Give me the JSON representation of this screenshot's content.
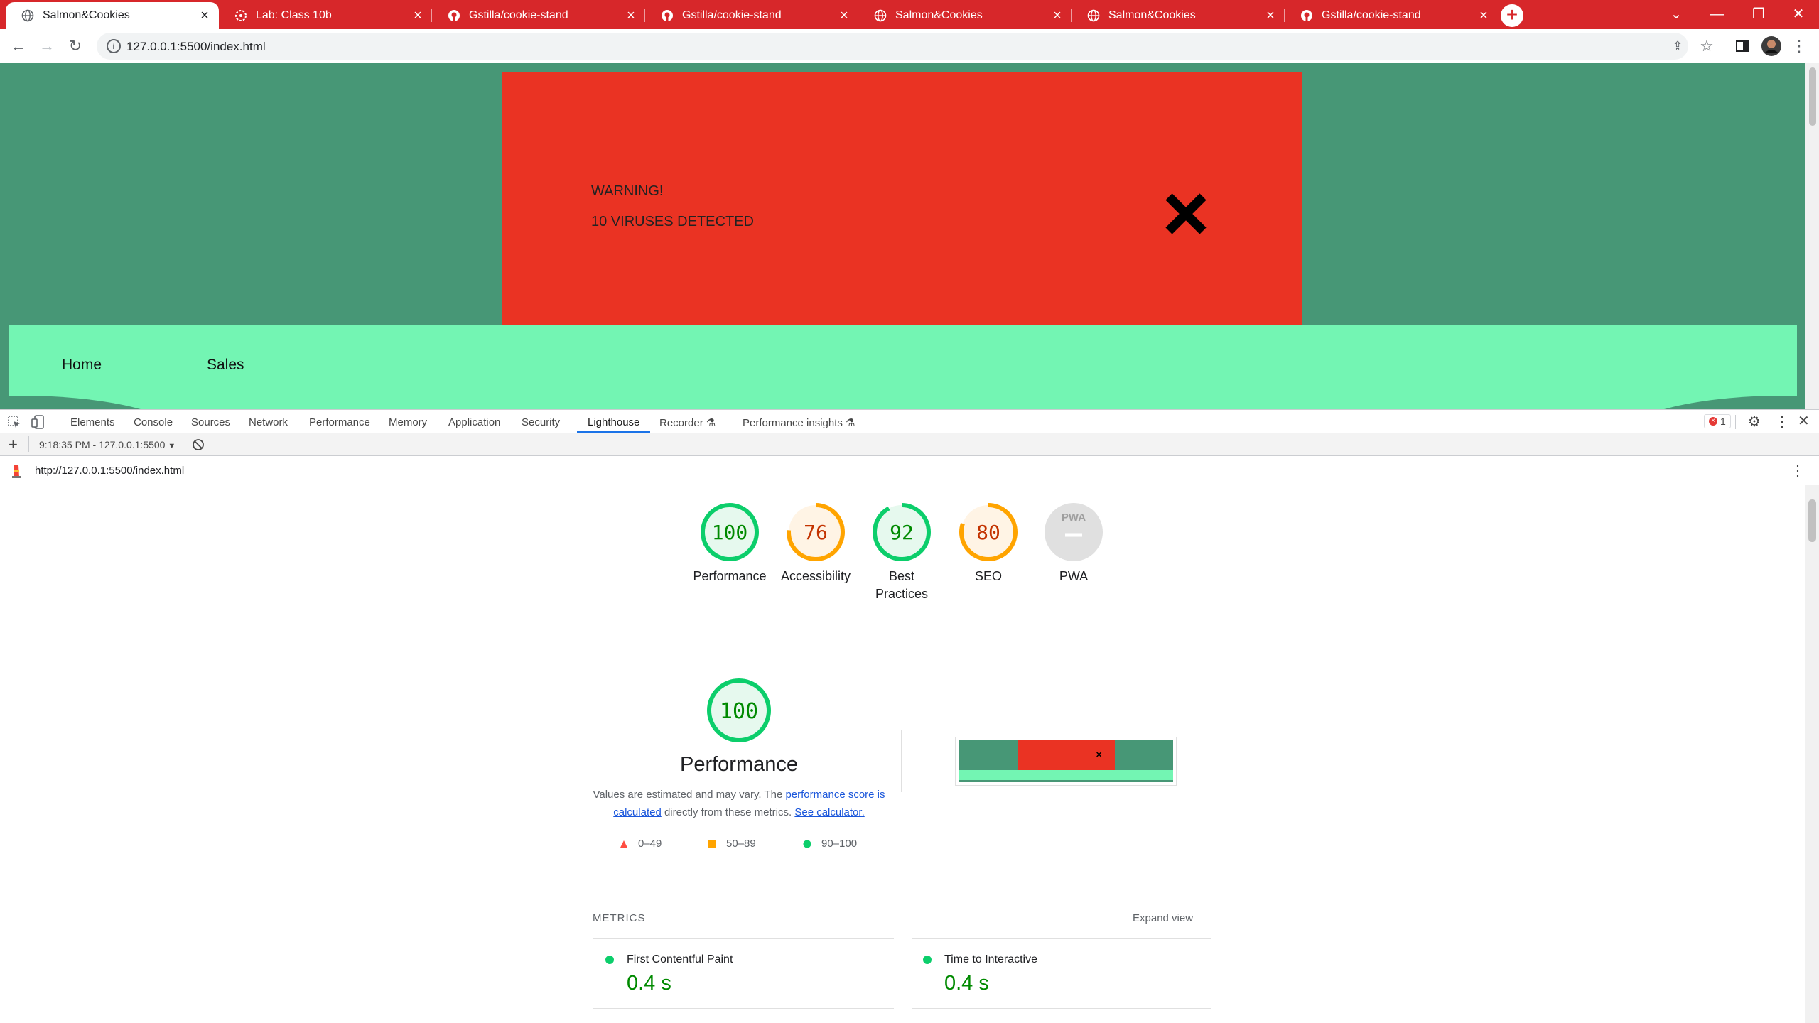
{
  "browser": {
    "tabs": [
      {
        "title": "Salmon&Cookies",
        "favicon": "globe-icon",
        "active": true
      },
      {
        "title": "Lab: Class 10b",
        "favicon": "canvas-icon",
        "active": false
      },
      {
        "title": "Gstilla/cookie-stand",
        "favicon": "github-icon",
        "active": false
      },
      {
        "title": "Gstilla/cookie-stand",
        "favicon": "github-icon",
        "active": false
      },
      {
        "title": "Salmon&Cookies",
        "favicon": "globe-icon",
        "active": false
      },
      {
        "title": "Salmon&Cookies",
        "favicon": "globe-icon",
        "active": false
      },
      {
        "title": "Gstilla/cookie-stand",
        "favicon": "github-icon",
        "active": false
      }
    ],
    "address": "127.0.0.1:5500/index.html",
    "accent_color": "#d7272a"
  },
  "page": {
    "warning_title": "WARNING!",
    "warning_text": "10 VIRUSES DETECTED",
    "nav": {
      "home": "Home",
      "sales": "Sales"
    },
    "colors": {
      "background": "#479776",
      "banner": "#ea3323",
      "nav": "#73f5b3"
    }
  },
  "devtools": {
    "tabs": [
      "Elements",
      "Console",
      "Sources",
      "Network",
      "Performance",
      "Memory",
      "Application",
      "Security",
      "Lighthouse",
      "Recorder",
      "Performance insights"
    ],
    "active_tab": "Lighthouse",
    "error_count": "1",
    "report_selector": "9:18:35 PM - 127.0.0.1:5500",
    "report_url": "http://127.0.0.1:5500/index.html"
  },
  "lighthouse": {
    "scores": [
      {
        "label": "Performance",
        "score": "100",
        "value": 100,
        "color": "#0cce6b",
        "text_color": "#008a00"
      },
      {
        "label": "Accessibility",
        "score": "76",
        "value": 76,
        "color": "#ffa400",
        "text_color": "#c33300"
      },
      {
        "label": "Best Practices",
        "score": "92",
        "value": 92,
        "color": "#0cce6b",
        "text_color": "#008a00"
      },
      {
        "label": "SEO",
        "score": "80",
        "value": 80,
        "color": "#ffa400",
        "text_color": "#c33300"
      },
      {
        "label": "PWA",
        "score": "PWA",
        "value": 0,
        "color": "#e0e0e0",
        "text_color": "#9e9e9e"
      }
    ],
    "performance": {
      "score": "100",
      "title": "Performance",
      "desc_1": "Values are estimated and may vary. The ",
      "link_1": "performance score is calculated",
      "desc_2": " directly from these metrics. ",
      "link_2": "See calculator."
    },
    "legend": [
      {
        "range": "0–49",
        "shape": "triangle",
        "color": "#ff4e42"
      },
      {
        "range": "50–89",
        "shape": "square",
        "color": "#ffa400"
      },
      {
        "range": "90–100",
        "shape": "circle",
        "color": "#0cce6b"
      }
    ],
    "metrics_header": "METRICS",
    "expand_label": "Expand view",
    "metrics": [
      {
        "name": "First Contentful Paint",
        "value": "0.4 s"
      },
      {
        "name": "Time to Interactive",
        "value": "0.4 s"
      }
    ]
  }
}
